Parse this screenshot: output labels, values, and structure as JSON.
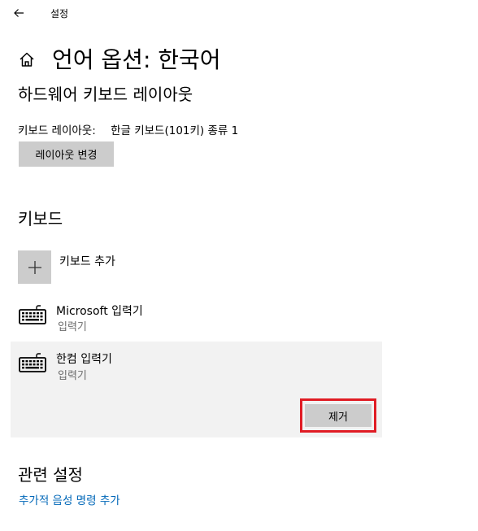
{
  "titlebar": {
    "app_title": "설정",
    "back_icon": "back-arrow-icon"
  },
  "header": {
    "home_icon": "home-icon",
    "title": "언어 옵션: 한국어"
  },
  "hardware_layout": {
    "heading": "하드웨어 키보드 레이아웃",
    "layout_label": "키보드 레이아웃:",
    "layout_value": "한글 키보드(101키) 종류 1",
    "change_button": "레이아웃 변경"
  },
  "keyboards": {
    "heading": "키보드",
    "add_label": "키보드 추가",
    "items": [
      {
        "name": "Microsoft 입력기",
        "sub": "입력기",
        "icon": "keyboard-icon"
      },
      {
        "name": "한컴 입력기",
        "sub": "입력기",
        "icon": "keyboard-icon",
        "selected": true
      }
    ],
    "remove_button": "제거"
  },
  "related": {
    "heading": "관련 설정",
    "link": "추가적 음성 명령 추가"
  },
  "colors": {
    "button_bg": "#cccccc",
    "selected_bg": "#f2f2f2",
    "highlight_border": "#e01c24",
    "link": "#0067b8",
    "secondary_text": "#6b6b6b"
  }
}
